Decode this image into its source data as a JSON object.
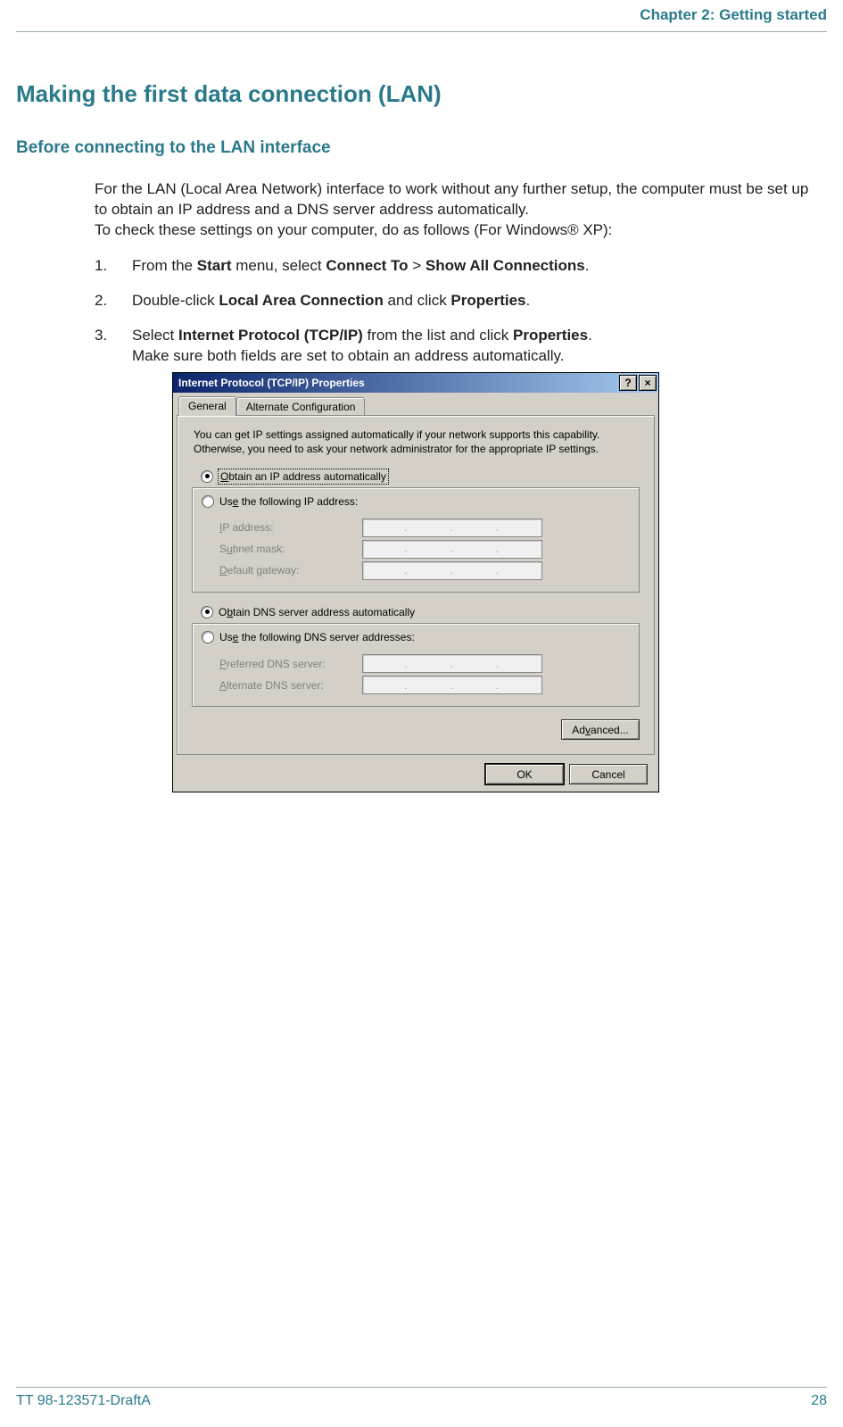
{
  "header": {
    "chapter": "Chapter 2: Getting started"
  },
  "section_title": "Making the first data connection (LAN)",
  "subsection_title": "Before connecting to the LAN interface",
  "intro_line1": "For the LAN (Local Area Network) interface to work without any further setup, the computer must be set up to obtain an IP address and a DNS server address automatically.",
  "intro_line2": "To check these settings on your computer, do as follows (For Windows® XP):",
  "steps": [
    {
      "num": "1.",
      "pre": "From the ",
      "b1": "Start",
      "mid1": " menu, select ",
      "b2": "Connect To",
      "mid2": " > ",
      "b3": "Show All Connections",
      "post": "."
    },
    {
      "num": "2.",
      "pre": "Double-click ",
      "b1": "Local Area Connection",
      "mid1": " and click ",
      "b2": "Properties",
      "post": "."
    },
    {
      "num": "3.",
      "pre": "Select ",
      "b1": "Internet Protocol (TCP/IP)",
      "mid1": " from the list and click ",
      "b2": "Properties",
      "post": ".",
      "line2": "Make sure both fields are set to obtain an address automatically."
    }
  ],
  "dialog": {
    "title": "Internet Protocol (TCP/IP) Properties",
    "help_btn": "?",
    "close_btn": "×",
    "tabs": {
      "general": "General",
      "alt": "Alternate Configuration"
    },
    "desc": "You can get IP settings assigned automatically if your network supports this capability. Otherwise, you need to ask your network administrator for the appropriate IP settings.",
    "radio_ip_auto_pre": "O",
    "radio_ip_auto_rest": "btain an IP address automatically",
    "radio_ip_manual_pre": "Us",
    "radio_ip_manual_u": "e",
    "radio_ip_manual_rest": " the following IP address:",
    "ip_label": "IP address:",
    "subnet_label_pre": "S",
    "subnet_label_u": "u",
    "subnet_label_rest": "bnet mask:",
    "gateway_label_pre": "",
    "gateway_label_u": "D",
    "gateway_label_rest": "efault gateway:",
    "radio_dns_auto_pre": "O",
    "radio_dns_auto_u": "b",
    "radio_dns_auto_rest": "tain DNS server address automatically",
    "radio_dns_manual_pre": "Us",
    "radio_dns_manual_u": "e",
    "radio_dns_manual_rest": " the following DNS server addresses:",
    "pref_dns_label_pre": "",
    "pref_dns_label_u": "P",
    "pref_dns_label_rest": "referred DNS server:",
    "alt_dns_label_pre": "",
    "alt_dns_label_u": "A",
    "alt_dns_label_rest": "lternate DNS server:",
    "advanced_btn_pre": "Ad",
    "advanced_btn_u": "v",
    "advanced_btn_rest": "anced...",
    "ok_btn": "OK",
    "cancel_btn": "Cancel"
  },
  "footer": {
    "doc_id": "TT 98-123571-DraftA",
    "page": "28"
  }
}
